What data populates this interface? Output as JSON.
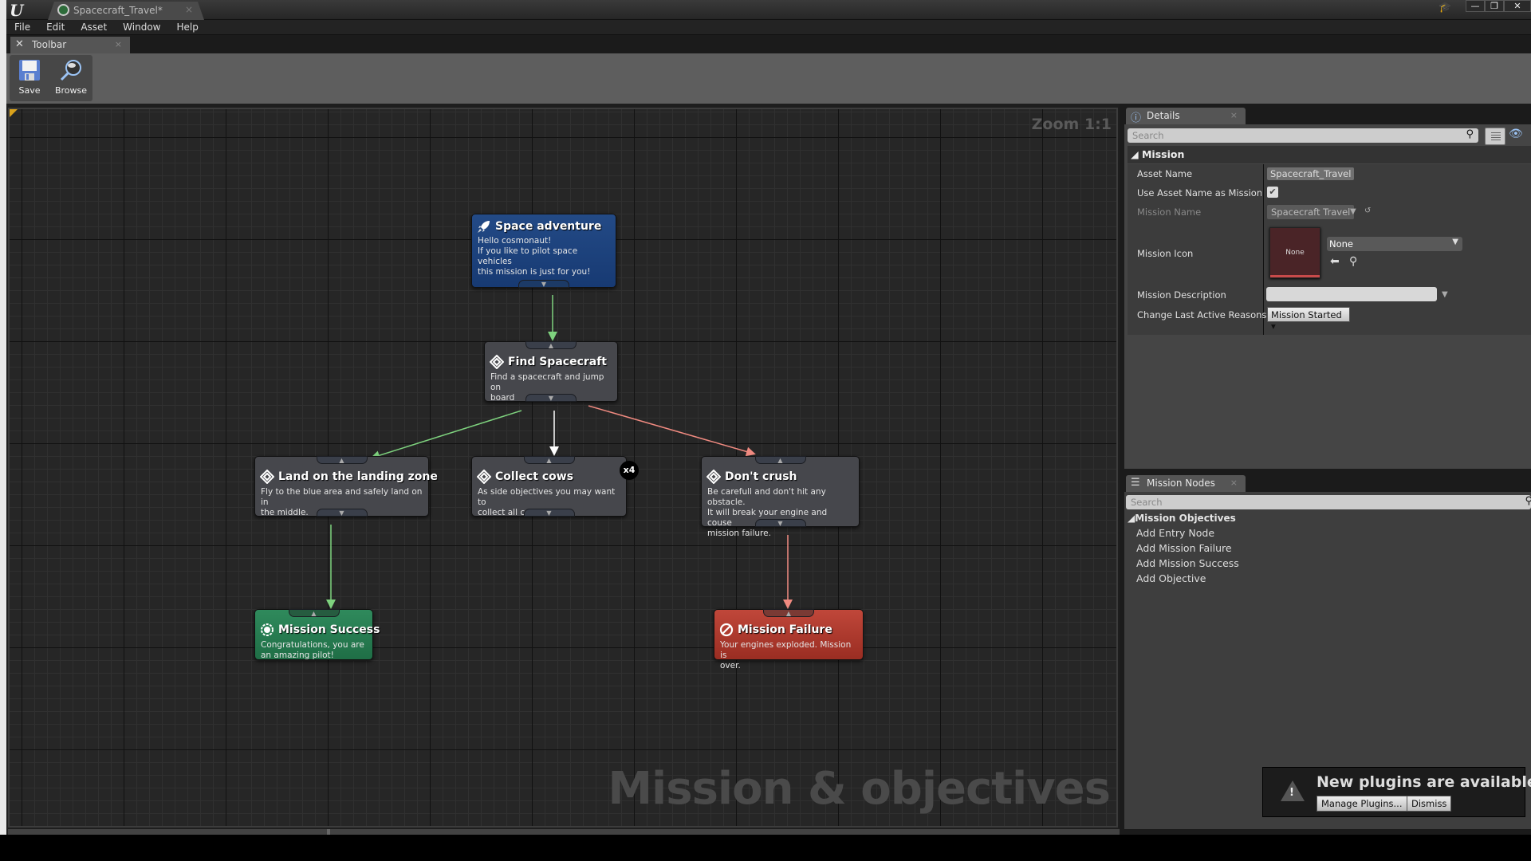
{
  "window": {
    "document_tab": "Spacecraft_Travel*",
    "close_glyph": "×",
    "controls": {
      "minimize": "—",
      "restore": "❐",
      "close": "✕"
    }
  },
  "menu": [
    "File",
    "Edit",
    "Asset",
    "Window",
    "Help"
  ],
  "toolbar": {
    "tab_label": "Toolbar",
    "save_label": "Save",
    "browse_label": "Browse"
  },
  "graph": {
    "zoom_label": "Zoom 1:1",
    "watermark": "Mission & objectives",
    "nodes": {
      "entry": {
        "title": "Space adventure",
        "description": "Hello cosmonaut!\nIf you like to pilot space vehicles\nthis mission is just for you!",
        "icon": "rocket-icon",
        "color": "#1d4279"
      },
      "find": {
        "title": "Find Spacecraft",
        "description": "Find a spacecraft and jump on\nboard",
        "icon": "objective-diamond-icon"
      },
      "land": {
        "title": "Land on the landing zone",
        "description": "Fly to the blue area and safely land on in\nthe middle.",
        "icon": "objective-diamond-icon"
      },
      "cows": {
        "title": "Collect cows",
        "description": "As side objectives you may want to\ncollect all cows",
        "icon": "objective-diamond-icon",
        "count_badge": "x4"
      },
      "crush": {
        "title": "Don't crush",
        "description": "Be carefull and don't hit any obstacle.\nIt will break your engine and couse\nmission failure.",
        "icon": "objective-diamond-icon"
      },
      "success": {
        "title": "Mission Success",
        "description": "Congratulations, you are\nan amazing pilot!",
        "icon": "award-icon",
        "color": "#277d50"
      },
      "failure": {
        "title": "Mission Failure",
        "description": "Your engines exploded. Mission is\nover.",
        "icon": "prohibited-icon",
        "color": "#ad3a2e"
      }
    },
    "wire_colors": {
      "success": "#7ed27e",
      "neutral": "#ffffff",
      "failure": "#f08a80"
    }
  },
  "details": {
    "tab_label": "Details",
    "search_placeholder": "Search",
    "category": "Mission",
    "props": {
      "asset_name_label": "Asset Name",
      "asset_name_value": "Spacecraft_Travel",
      "use_asset_name_label": "Use Asset Name as Mission Na",
      "use_asset_name_checked": true,
      "check_glyph": "✔",
      "mission_name_label": "Mission Name",
      "mission_name_value": "Spacecraft Travel",
      "mission_icon_label": "Mission Icon",
      "mission_icon_thumb": "None",
      "mission_icon_value": "None",
      "mission_description_label": "Mission Description",
      "mission_description_value": "",
      "change_reasons_label": "Change Last Active Reasons",
      "change_reasons_value": "Mission Started"
    }
  },
  "mission_nodes": {
    "tab_label": "Mission Nodes",
    "search_placeholder": "Search",
    "category": "Mission Objectives",
    "items": [
      "Add Entry Node",
      "Add Mission Failure",
      "Add Mission Success",
      "Add Objective"
    ]
  },
  "notification": {
    "text": "New plugins are available",
    "manage_label": "Manage Plugins...",
    "dismiss_label": "Dismiss"
  }
}
